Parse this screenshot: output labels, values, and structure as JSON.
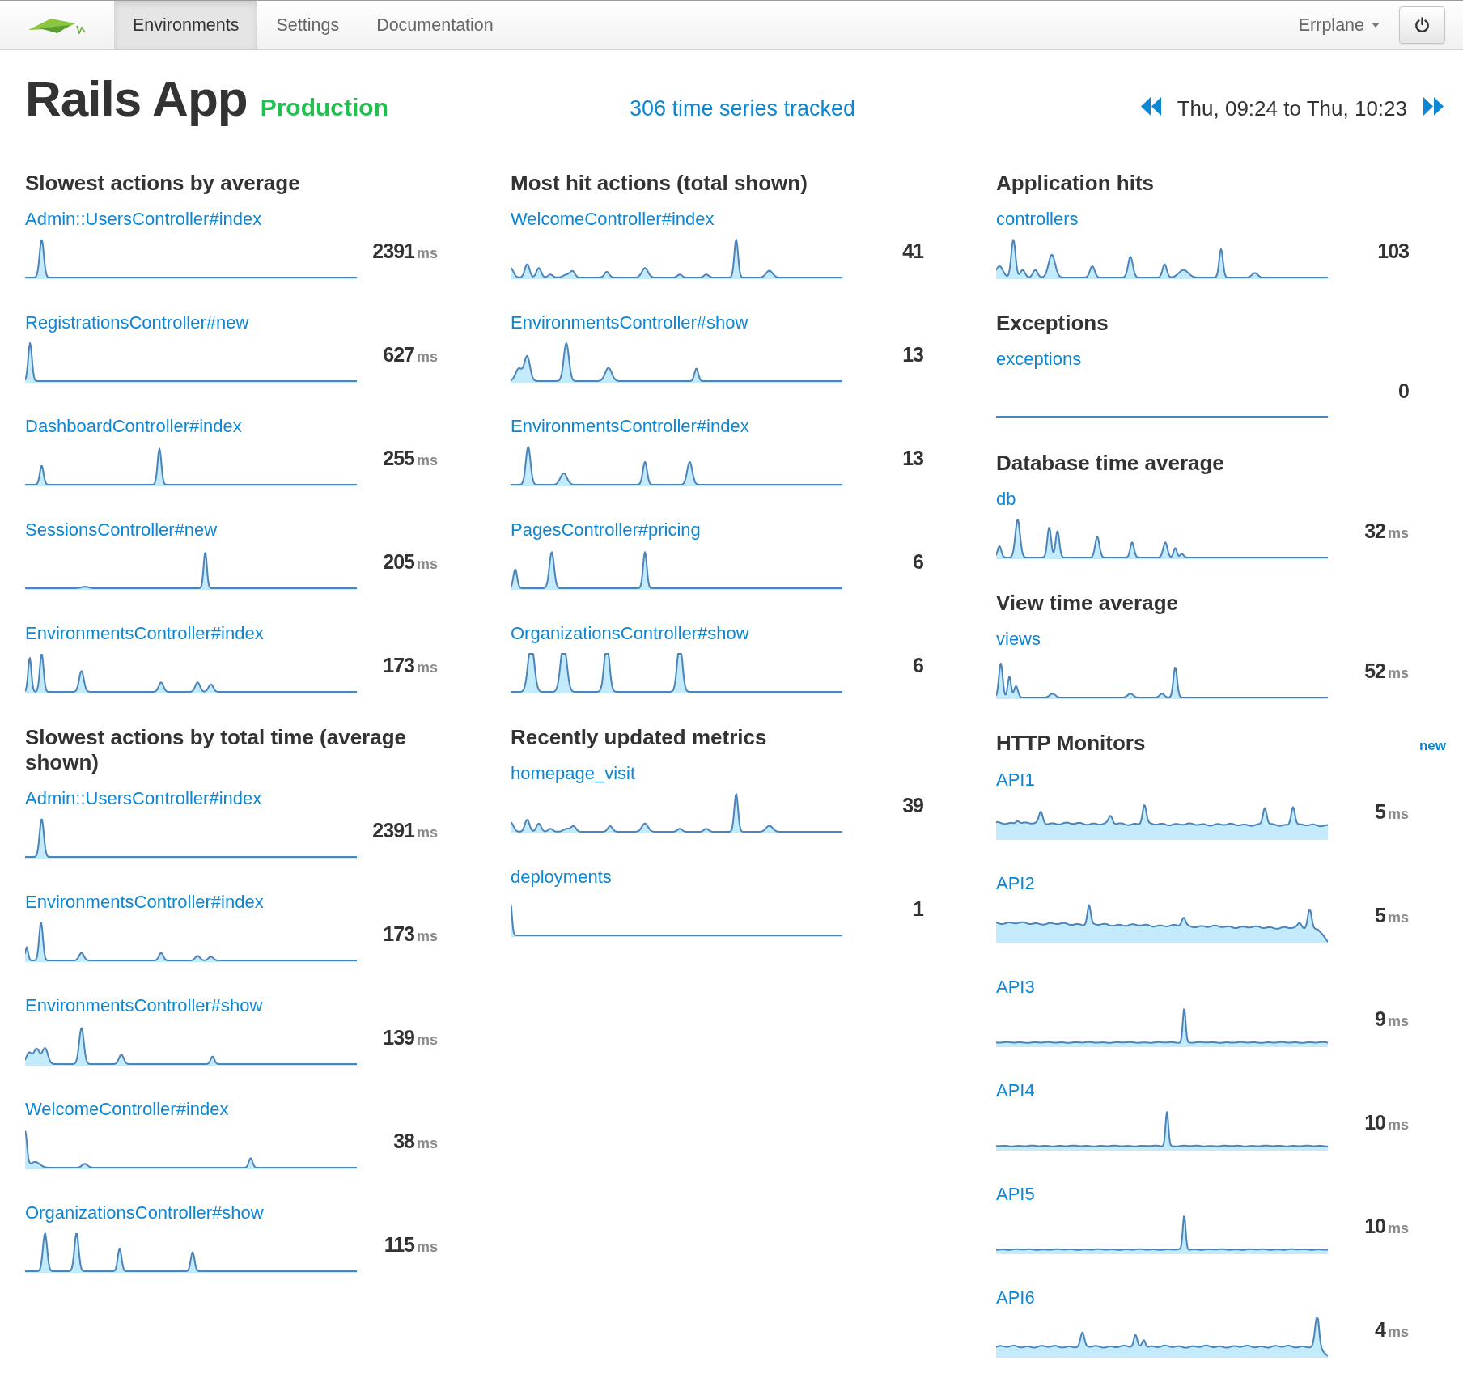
{
  "navbar": {
    "tabs": [
      {
        "label": "Environments",
        "selected": true
      },
      {
        "label": "Settings",
        "selected": false
      },
      {
        "label": "Documentation",
        "selected": false
      }
    ],
    "account_menu": {
      "label": "Errplane"
    }
  },
  "header": {
    "title": "Rails App",
    "environment": "Production",
    "series_link": "306 time series tracked",
    "time_range": "Thu, 09:24 to Thu, 10:23"
  },
  "columns": [
    {
      "sections": [
        {
          "title": "Slowest actions by average",
          "items": [
            {
              "label": "Admin::UsersController#index",
              "value": "2391",
              "unit": "ms"
            },
            {
              "label": "RegistrationsController#new",
              "value": "627",
              "unit": "ms"
            },
            {
              "label": "DashboardController#index",
              "value": "255",
              "unit": "ms"
            },
            {
              "label": "SessionsController#new",
              "value": "205",
              "unit": "ms"
            },
            {
              "label": "EnvironmentsController#index",
              "value": "173",
              "unit": "ms"
            }
          ]
        },
        {
          "title": "Slowest actions by total time (average shown)",
          "items": [
            {
              "label": "Admin::UsersController#index",
              "value": "2391",
              "unit": "ms"
            },
            {
              "label": "EnvironmentsController#index",
              "value": "173",
              "unit": "ms"
            },
            {
              "label": "EnvironmentsController#show",
              "value": "139",
              "unit": "ms"
            },
            {
              "label": "WelcomeController#index",
              "value": "38",
              "unit": "ms"
            },
            {
              "label": "OrganizationsController#show",
              "value": "115",
              "unit": "ms"
            }
          ]
        }
      ]
    },
    {
      "sections": [
        {
          "title": "Most hit actions (total shown)",
          "items": [
            {
              "label": "WelcomeController#index",
              "value": "41"
            },
            {
              "label": "EnvironmentsController#show",
              "value": "13"
            },
            {
              "label": "EnvironmentsController#index",
              "value": "13"
            },
            {
              "label": "PagesController#pricing",
              "value": "6"
            },
            {
              "label": "OrganizationsController#show",
              "value": "6"
            }
          ]
        },
        {
          "title": "Recently updated metrics",
          "items": [
            {
              "label": "homepage_visit",
              "value": "39"
            },
            {
              "label": "deployments",
              "value": "1"
            }
          ]
        }
      ]
    },
    {
      "sections": [
        {
          "title": "Application hits",
          "items": [
            {
              "label": "controllers",
              "value": "103"
            }
          ]
        },
        {
          "title": "Exceptions",
          "items": [
            {
              "label": "exceptions",
              "value": "0"
            }
          ]
        },
        {
          "title": "Database time average",
          "items": [
            {
              "label": "db",
              "value": "32",
              "unit": "ms"
            }
          ]
        },
        {
          "title": "View time average",
          "items": [
            {
              "label": "views",
              "value": "52",
              "unit": "ms"
            }
          ]
        },
        {
          "title": "HTTP Monitors",
          "action": "new",
          "items": [
            {
              "label": "API1",
              "value": "5",
              "unit": "ms"
            },
            {
              "label": "API2",
              "value": "5",
              "unit": "ms"
            },
            {
              "label": "API3",
              "value": "9",
              "unit": "ms"
            },
            {
              "label": "API4",
              "value": "10",
              "unit": "ms"
            },
            {
              "label": "API5",
              "value": "10",
              "unit": "ms"
            },
            {
              "label": "API6",
              "value": "4",
              "unit": "ms"
            }
          ]
        }
      ]
    }
  ]
}
